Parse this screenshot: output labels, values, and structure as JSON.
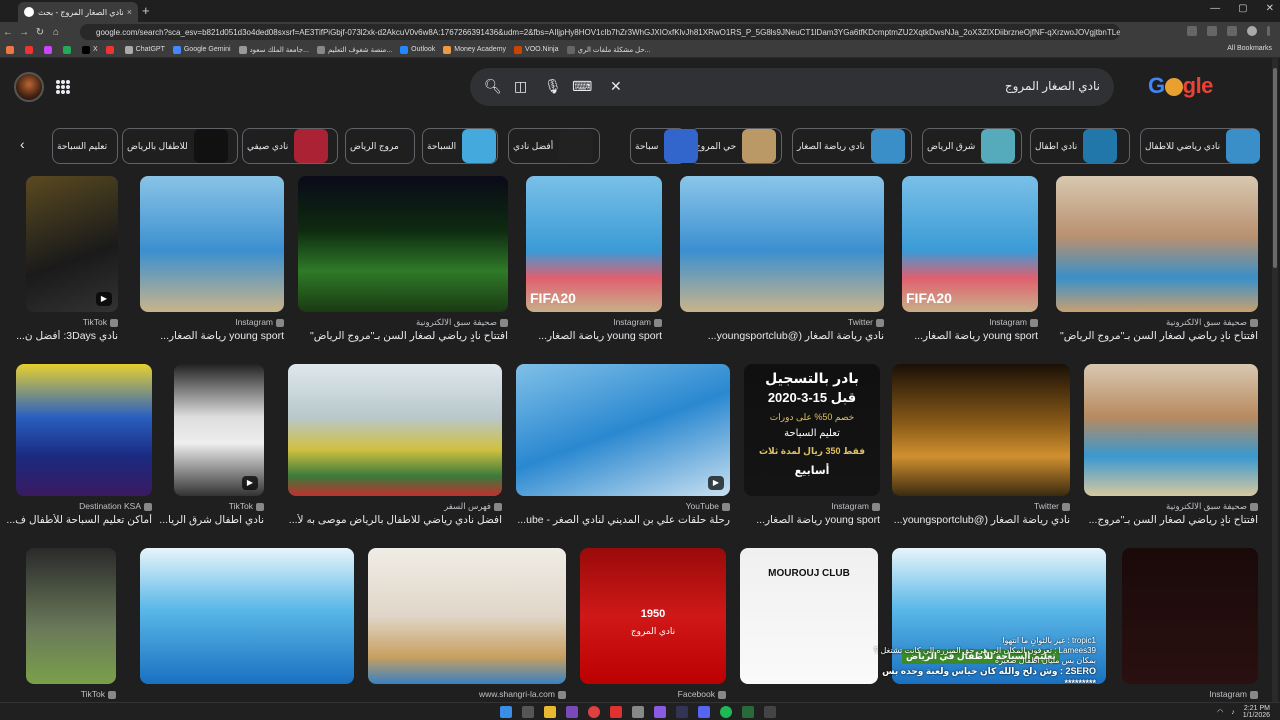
{
  "tab": {
    "title": "نادي الصغار المروج - بحث Google",
    "close": "×"
  },
  "newtab_label": "+",
  "window_controls": [
    "—",
    "▢",
    "✕"
  ],
  "address_bar": {
    "url": "google.com/search?sca_esv=b821d051d3o4ded08sxsrf=AE3TifPiGbjf-073l2xk-d2AkcuV0v6w8A:1767266391436&udm=2&fbs=AIljpHy8HOV1cIb7hZr3WhGJXIOxfKlvJh81XRwO1RS_P_5G8ls9JNeuCT1lDam3YGa6tfKDcmptmZU2XqtkDwsNJa_2oX3ZIXDiibrzneOjfNF-qXrzwoJOVgjtbnTLeBCjvlNquy657iHPjJxp3B3SGJW-jzeJxyu-T27grQ..."
  },
  "bookmarks": [
    {
      "label": "",
      "color": "#e74"
    },
    {
      "label": "",
      "color": "#e33"
    },
    {
      "label": "",
      "color": "#c4f"
    },
    {
      "label": "",
      "color": "#2a5"
    },
    {
      "label": "X",
      "color": "#000"
    },
    {
      "label": "",
      "color": "#e33"
    },
    {
      "label": "ChatGPT",
      "color": "#aaa"
    },
    {
      "label": "Google Gemini",
      "color": "#48f"
    },
    {
      "label": "جامعة الملك سعود...",
      "color": "#999"
    },
    {
      "label": "منصة شغوف التعليم...",
      "color": "#888"
    },
    {
      "label": "Outlook",
      "color": "#28f"
    },
    {
      "label": "Money Academy",
      "color": "#e94"
    },
    {
      "label": "VOO.Ninja",
      "color": "#c40"
    },
    {
      "label": "حل مشكلة ملفات الري...",
      "color": "#666"
    }
  ],
  "all_bookmarks": "All Bookmarks",
  "search": {
    "query": "نادي الصغار المروج"
  },
  "logo": {
    "l1": "G",
    "l2": "gle"
  },
  "chips": [
    {
      "label": "نادي رياضي للاطفال",
      "color": "#3a8fc8"
    },
    {
      "label": "نادي اطفال",
      "color": "#2277aa"
    },
    {
      "label": "شرق الرياض",
      "color": "#5ab"
    },
    {
      "label": "نادي رياضة الصغار",
      "color": "#3a8fc8"
    },
    {
      "label": "حي المروج",
      "color": "#b96"
    },
    {
      "label": "سباحة",
      "color": "#36c"
    },
    {
      "label": "أفضل نادي",
      "color": "#222"
    },
    {
      "label": "السباحة",
      "color": "#4ad"
    },
    {
      "label": "مروج الرياض",
      "color": ""
    },
    {
      "label": "نادي صيفي",
      "color": "#a23"
    },
    {
      "label": "للاطفال بالرياض",
      "color": "#111"
    },
    {
      "label": "تعليم السباحة",
      "color": ""
    }
  ],
  "results": [
    {
      "source": "TikTok",
      "title": "نادي 3Days: أفضل ن...",
      "bg": "linear-gradient(160deg,#5a4a20,#1a1a1a 60%,#333)",
      "video": true
    },
    {
      "source": "Instagram",
      "title": "young sport رياضة الصغار...",
      "bg": "linear-gradient(180deg,#8ac4e6,#3b8fd0 55%,#c9b48a)",
      "video": false
    },
    {
      "source": "صحيفة سبق الالكترونية",
      "title": "افتتاح نادٍ رياضي لصغار السن بـ\"مروج الرياض\"",
      "bg": "linear-gradient(180deg,#0a0a18,#0e2a10 40%,#2f7a28 70%,#1a3a12)",
      "video": false
    },
    {
      "source": "Instagram",
      "title": "young sport رياضة الصغار...",
      "bg": "linear-gradient(180deg,#7ac0e8,#3a9bd6 55%,#e06070 75%,#c8b088)",
      "video": false
    },
    {
      "source": "Twitter",
      "title": "نادي رياضة الصغار (@youngsportclub...",
      "bg": "linear-gradient(180deg,#8bc6ea,#3b8fd0 55%,#c9b48a)",
      "video": false
    },
    {
      "source": "Instagram",
      "title": "young sport رياضة الصغار...",
      "bg": "linear-gradient(180deg,#7ac0e8,#3a9bd6 55%,#e06070 75%,#c8b088)",
      "video": false
    },
    {
      "source": "صحيفة سبق الالكترونية",
      "title": "افتتاح نادٍ رياضي لصغار السن بـ\"مروج الرياض\"",
      "bg": "linear-gradient(180deg,#d8c8b0,#b89070 45%,#3a90c8 75%,#c8a070)",
      "video": false
    },
    {
      "source": "Destination KSA",
      "title": "أماكن تعليم السباحة للأطفال ف...",
      "bg": "linear-gradient(180deg,#e6d030,#2a60c0 40%,#1a2a80 70%,#3a1a60)",
      "video": false
    },
    {
      "source": "TikTok",
      "title": "نادي اطفال شرق الريا...",
      "bg": "linear-gradient(180deg,#222,#ddd 40%,#eee 60%,#333)",
      "video": true
    },
    {
      "source": "فهرس السفر",
      "title": "افضل نادي رياضي للاطفال بالرياض موصى به لأ...",
      "bg": "linear-gradient(180deg,#dfe8ec,#b8c8cc 40%,#d0c040 65%,#3a7a3a 85%,#c03030)",
      "video": false
    },
    {
      "source": "YouTube",
      "title": "رحلة حلقات علي بن المديني لنادي الصغر - ube...",
      "bg": "linear-gradient(160deg,#80c0e8,#2a88d0 50%,#c9e0f0)",
      "video": true
    },
    {
      "source": "Instagram",
      "title": "young sport رياضة الصغار...",
      "bg": "linear-gradient(180deg,#101010,#141414)",
      "video": false
    },
    {
      "source": "Twitter",
      "title": "نادي رياضة الصغار (@youngsportclub...",
      "bg": "linear-gradient(180deg,#1a1006,#8a5a18 45%,#d09030 70%,#3a2a10)",
      "video": false
    },
    {
      "source": "صحيفة سبق الالكترونية",
      "title": "افتتاح نادٍ رياضي لصغار السن بـ\"مروج...",
      "bg": "linear-gradient(180deg,#d8c8b0,#b88a60 40%,#3a98d0 70%,#d8c8a0)",
      "video": false
    },
    {
      "source": "TikTok",
      "title": "",
      "bg": "linear-gradient(180deg,#2a2a2a,#6a7a5a 60%,#7aa04a)",
      "video": false
    },
    {
      "source": "",
      "title": "",
      "bg": "linear-gradient(180deg,#e8f4fa,#5ab8e8 45%,#1a70c0)",
      "video": false
    },
    {
      "source": "www.shangri-la.com",
      "title": "",
      "bg": "linear-gradient(180deg,#f0ede6,#e0d6c8 50%,#c8a060 80%,#3a80c0)",
      "video": false
    },
    {
      "source": "Facebook",
      "title": "",
      "bg": "linear-gradient(180deg,#9a0a0a,#d01818 50%,#b00)",
      "video": false
    },
    {
      "source": "",
      "title": "",
      "bg": "linear-gradient(180deg,#f0f0f0,#fafafa)",
      "video": false
    },
    {
      "source": "",
      "title": "",
      "bg": "linear-gradient(180deg,#e8f4fa,#5ab8e8 45%,#1a70c0)",
      "video": false
    },
    {
      "source": "Instagram",
      "title": "",
      "bg": "linear-gradient(180deg,#1a0a0a,#2a1010)",
      "video": false
    }
  ],
  "tile_text": {
    "fifa": "FIFA20",
    "poster_line1": "بادر بالتسجيل",
    "poster_line2": "قبل 15-3-2020",
    "poster_line3": "خصم 50% على دورات",
    "poster_line4": "تعليم السباحة",
    "poster_line5": "فقط 350 ريال لمدة ثلاث",
    "poster_line6": "أسابيع",
    "club1": "MOUROUJ CLUB",
    "swim_banner": "تعليم السباحة للأطفال في الرياض",
    "red_year": "1950",
    "red_name": "نادي المروج"
  },
  "overlay": [
    {
      "text": "tropic1 : غير بالثوانِ ما انتهوا",
      "strong": false
    },
    {
      "text": "Lamees39 : تعرفون المكان الي هي حق المبزره الي كانت تشتغل ؟",
      "strong": false
    },
    {
      "text": "بمكان بس مليان اطفال صغيره",
      "strong": false
    },
    {
      "text": "2SERO : وش دلخ والله كان خياس ولعبة وحده بس",
      "strong": true
    },
    {
      "text": "*********",
      "strong": true
    }
  ],
  "clock": {
    "time": "2:21 PM",
    "date": "1/1/2026"
  },
  "colors": {
    "page_bg": "#1f1f1f",
    "chip_border": "#5f6368",
    "search_bg": "#303134"
  }
}
